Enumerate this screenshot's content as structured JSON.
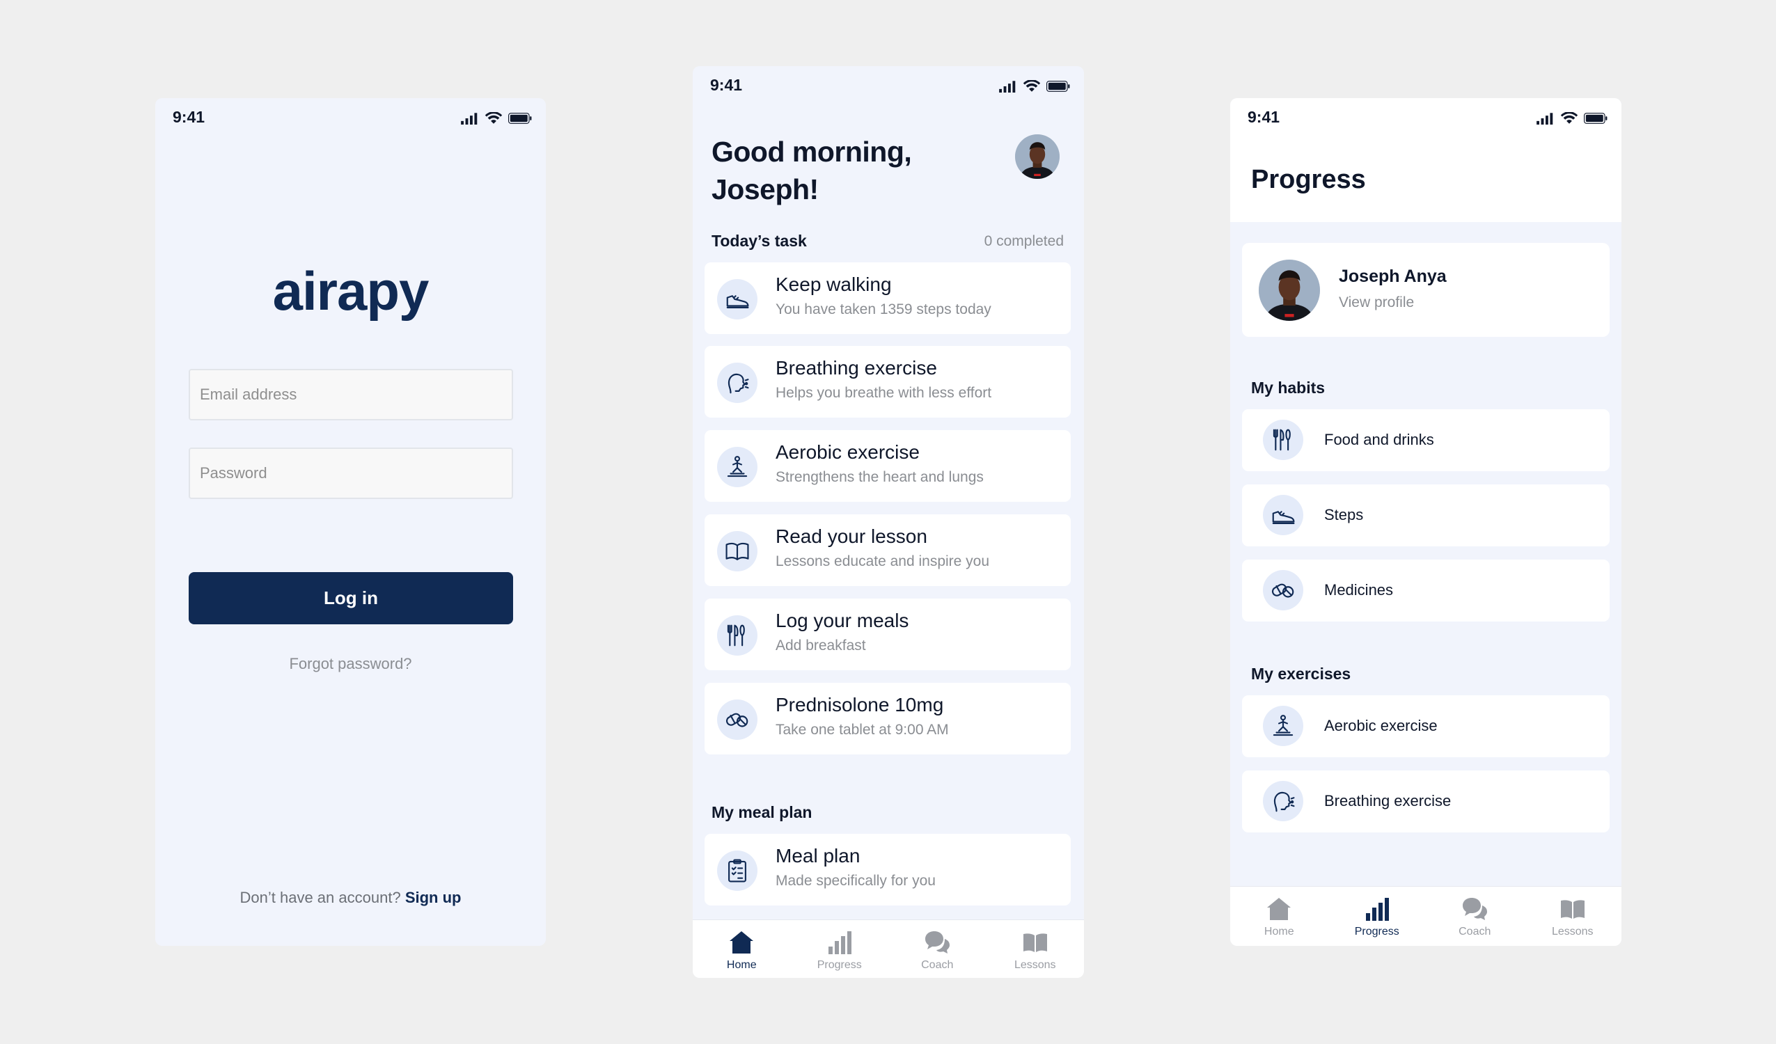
{
  "status_time": "9:41",
  "login": {
    "logo": "airapy",
    "email_placeholder": "Email address",
    "password_placeholder": "Password",
    "login_label": "Log in",
    "forgot_label": "Forgot password?",
    "signup_prompt": "Don’t have an account?",
    "signup_link": "Sign up"
  },
  "home": {
    "greeting": "Good morning, Joseph!",
    "today_label": "Today’s task",
    "completed_label": "0 completed",
    "tasks": [
      {
        "title": "Keep walking",
        "subtitle": "You have taken 1359 steps today",
        "icon": "sneaker-icon"
      },
      {
        "title": "Breathing exercise",
        "subtitle": "Helps you breathe with less effort",
        "icon": "breathing-icon"
      },
      {
        "title": "Aerobic exercise",
        "subtitle": "Strengthens the heart and lungs",
        "icon": "aerobic-icon"
      },
      {
        "title": "Read your lesson",
        "subtitle": "Lessons educate and inspire you",
        "icon": "book-icon"
      },
      {
        "title": "Log your meals",
        "subtitle": "Add breakfast",
        "icon": "utensils-icon"
      },
      {
        "title": "Prednisolone 10mg",
        "subtitle": "Take one tablet at 9:00 AM",
        "icon": "pill-icon"
      }
    ],
    "meal_section_label": "My meal plan",
    "meal_card": {
      "title": "Meal plan",
      "subtitle": "Made specifically for you",
      "icon": "checklist-icon"
    }
  },
  "tabs": [
    {
      "label": "Home",
      "icon": "home-icon"
    },
    {
      "label": "Progress",
      "icon": "bar-chart-icon"
    },
    {
      "label": "Coach",
      "icon": "chat-icon"
    },
    {
      "label": "Lessons",
      "icon": "book-open-icon"
    }
  ],
  "progress": {
    "title": "Progress",
    "profile_name": "Joseph Anya",
    "profile_link": "View profile",
    "habits_label": "My habits",
    "habits": [
      {
        "label": "Food and drinks",
        "icon": "utensils-icon"
      },
      {
        "label": "Steps",
        "icon": "sneaker-icon"
      },
      {
        "label": "Medicines",
        "icon": "pill-icon"
      }
    ],
    "exercises_label": "My exercises",
    "exercises": [
      {
        "label": "Aerobic exercise",
        "icon": "aerobic-icon"
      },
      {
        "label": "Breathing exercise",
        "icon": "breathing-icon"
      }
    ]
  },
  "colors": {
    "brand": "#102a54",
    "background": "#efefef",
    "screen": "#f1f4fc",
    "icon_bg": "#e4ebf9",
    "muted": "#8a8d92"
  }
}
